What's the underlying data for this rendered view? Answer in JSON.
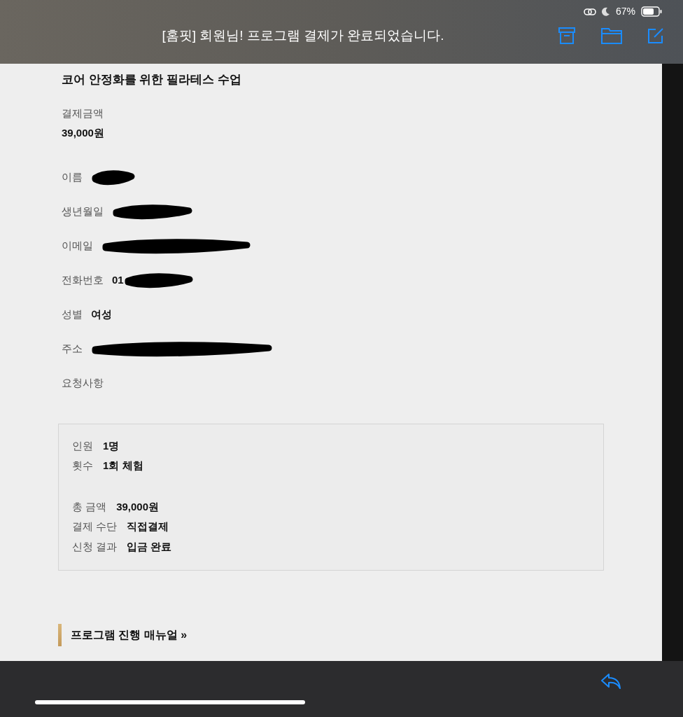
{
  "status_bar": {
    "battery": "67%"
  },
  "header": {
    "subject": "[홈핏] 회원님! 프로그램 결제가 완료되었습니다."
  },
  "program_title": "코어 안정화를 위한 필라테스 수업",
  "payment": {
    "label": "결제금액",
    "amount": "39,000원"
  },
  "fields": [
    {
      "label": "이름",
      "redacted": true
    },
    {
      "label": "생년월일",
      "redacted": true
    },
    {
      "label": "이메일",
      "redacted": true
    },
    {
      "label": "전화번호",
      "value": "01",
      "redacted": true
    },
    {
      "label": "성별",
      "value": "여성",
      "redacted": false
    },
    {
      "label": "주소",
      "redacted": true
    },
    {
      "label": "요청사항",
      "redacted": false
    }
  ],
  "summary": [
    [
      {
        "label": "인원",
        "value": "1명"
      },
      {
        "label": "횟수",
        "value": "1회 체험"
      }
    ],
    [
      {
        "label": "총 금액",
        "value": "39,000원"
      },
      {
        "label": "결제 수단",
        "value": "직접결제"
      },
      {
        "label": "신청 결과",
        "value": "입금 완료"
      }
    ]
  ],
  "manual_link": "프로그램 진행 매뉴얼 »"
}
